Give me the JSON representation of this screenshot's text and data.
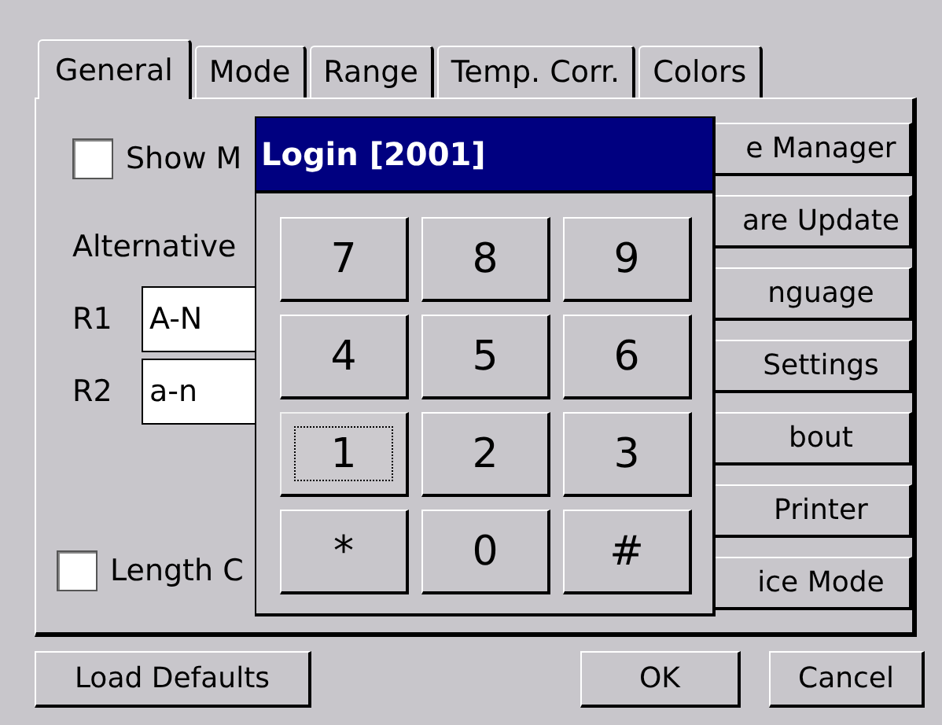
{
  "tabs": [
    {
      "label": "General",
      "selected": true
    },
    {
      "label": "Mode",
      "selected": false
    },
    {
      "label": "Range",
      "selected": false
    },
    {
      "label": "Temp. Corr.",
      "selected": false
    },
    {
      "label": "Colors",
      "selected": false
    }
  ],
  "show_checkbox": {
    "label": "Show M",
    "checked": false
  },
  "alternative_label": "Alternative",
  "fields": [
    {
      "label": "R1",
      "value": "A-N"
    },
    {
      "label": "R2",
      "value": "a-n"
    }
  ],
  "length_checkbox": {
    "label": "Length C",
    "checked": false
  },
  "side_buttons": [
    "e Manager",
    "are Update",
    "nguage",
    "Settings",
    "bout",
    "Printer",
    "ice Mode"
  ],
  "login_dialog": {
    "title": "Login [2001]",
    "keys": [
      {
        "label": "7",
        "focused": false
      },
      {
        "label": "8",
        "focused": false
      },
      {
        "label": "9",
        "focused": false
      },
      {
        "label": "4",
        "focused": false
      },
      {
        "label": "5",
        "focused": false
      },
      {
        "label": "6",
        "focused": false
      },
      {
        "label": "1",
        "focused": true
      },
      {
        "label": "2",
        "focused": false
      },
      {
        "label": "3",
        "focused": false
      },
      {
        "label": "*",
        "focused": false
      },
      {
        "label": "0",
        "focused": false
      },
      {
        "label": "#",
        "focused": false
      }
    ]
  },
  "bottom_buttons": {
    "left": "Load Defaults",
    "ok": "OK",
    "cancel": "Cancel"
  }
}
